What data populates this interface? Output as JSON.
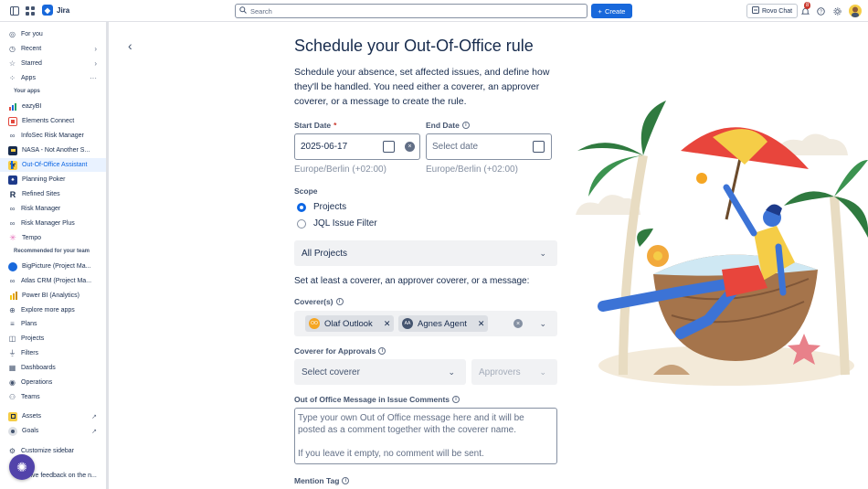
{
  "topbar": {
    "app_name": "Jira",
    "search_placeholder": "Search",
    "create_label": "Create",
    "rovo_label": "Rovo Chat",
    "notification_count": "8"
  },
  "sidebar": {
    "items_top": [
      {
        "label": "For you",
        "icon": "user-circle-icon"
      },
      {
        "label": "Recent",
        "icon": "clock-icon"
      },
      {
        "label": "Starred",
        "icon": "star-icon"
      },
      {
        "label": "Apps",
        "icon": "apps-icon"
      }
    ],
    "your_apps_heading": "Your apps",
    "apps": [
      {
        "label": "eazyBI",
        "icon": "eazybi-icon",
        "color": "#e2483d"
      },
      {
        "label": "Elements Connect",
        "icon": "elements-connect-icon",
        "color": "#e2483d"
      },
      {
        "label": "InfoSec Risk Manager",
        "icon": "infosec-icon",
        "color": "#44546f"
      },
      {
        "label": "NASA - Not Another S...",
        "icon": "nasa-icon",
        "color": "#172b4d"
      },
      {
        "label": "Out-Of-Office Assistant",
        "icon": "palm-tree-icon",
        "color": "#172b4d"
      },
      {
        "label": "Planning Poker",
        "icon": "planning-poker-icon",
        "color": "#1d3a8a"
      },
      {
        "label": "Refined Sites",
        "icon": "refined-icon",
        "color": "#172b4d"
      },
      {
        "label": "Risk Manager",
        "icon": "risk-manager-icon",
        "color": "#44546f"
      },
      {
        "label": "Risk Manager Plus",
        "icon": "risk-manager-plus-icon",
        "color": "#44546f"
      },
      {
        "label": "Tempo",
        "icon": "tempo-icon",
        "color": "#e774bb"
      }
    ],
    "recommended_heading": "Recommended for your team",
    "recommended": [
      {
        "label": "BigPicture (Project Ma...",
        "icon": "bigpicture-icon",
        "color": "#1868db"
      },
      {
        "label": "Atlas CRM (Project Ma...",
        "icon": "atlas-icon",
        "color": "#44546f"
      },
      {
        "label": "Power BI (Analytics)",
        "icon": "powerbi-icon",
        "color": "#f2c811"
      },
      {
        "label": "Explore more apps",
        "icon": "explore-icon",
        "color": "#44546f"
      }
    ],
    "items_bottom": [
      {
        "label": "Plans",
        "icon": "plans-icon"
      },
      {
        "label": "Projects",
        "icon": "projects-icon"
      },
      {
        "label": "Filters",
        "icon": "filter-icon"
      },
      {
        "label": "Dashboards",
        "icon": "dashboard-icon"
      },
      {
        "label": "Operations",
        "icon": "operations-icon"
      },
      {
        "label": "Teams",
        "icon": "teams-icon"
      }
    ],
    "assets_label": "Assets",
    "goals_label": "Goals",
    "customize_label": "Customize sidebar",
    "feedback_label": "Give feedback on the n..."
  },
  "form": {
    "title": "Schedule your Out-Of-Office rule",
    "intro": "Schedule your absence, set affected issues, and define how they'll be handled. You need either a coverer, an approver coverer, or a message to create the rule.",
    "start_date_label": "Start Date",
    "start_date_value": "2025-06-17",
    "start_tz": "Europe/Berlin (+02:00)",
    "end_date_label": "End Date",
    "end_date_placeholder": "Select date",
    "end_tz": "Europe/Berlin (+02:00)",
    "scope_label": "Scope",
    "scope_options": [
      "Projects",
      "JQL Issue Filter"
    ],
    "scope_selected": "Projects",
    "projects_select": "All Projects",
    "coverer_instruction": "Set at least a coverer, an approver coverer, or a message:",
    "coverers_label": "Coverer(s)",
    "coverers": [
      {
        "name": "Olaf Outlook",
        "initials": "OO"
      },
      {
        "name": "Agnes Agent",
        "initials": "AA"
      }
    ],
    "approvals_label": "Coverer for Approvals",
    "select_coverer_placeholder": "Select coverer",
    "approvers_placeholder": "Approvers",
    "message_label": "Out of Office Message in Issue Comments",
    "message_placeholder": "Type your own Out of Office message here and it will be posted as a comment together with the coverer name.\n\nIf you leave it empty, no comment will be sent.",
    "mention_label": "Mention Tag"
  },
  "colors": {
    "primary": "#1868db",
    "selected_bg": "#e9f2ff",
    "required": "#c9372c"
  }
}
